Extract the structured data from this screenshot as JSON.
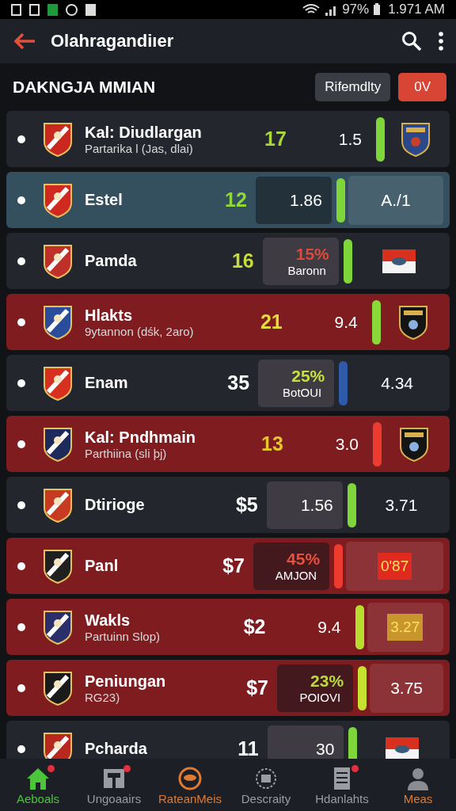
{
  "status_bar": {
    "battery": "97%",
    "time": "1.971 AM"
  },
  "app_bar": {
    "title": "Olahragandiıer"
  },
  "section": {
    "title": "DAKNGJA MMIAN",
    "buttons": [
      {
        "label": "Rifemdlty",
        "kind": "neutral"
      },
      {
        "label": "0V",
        "kind": "accent"
      }
    ]
  },
  "rows": [
    {
      "kind": "dark",
      "name": "Kal: Diudlargan",
      "sub": "Partarika l (Jas, dlai)",
      "count": {
        "text": "17",
        "color": "#a8d63c"
      },
      "value": {
        "kind": "plain",
        "text": "1.5"
      },
      "bar": {
        "color": "#7ed63a"
      },
      "right": {
        "kind": "crest"
      }
    },
    {
      "kind": "blue",
      "name": "Estel",
      "count": {
        "text": "12",
        "color": "#8fd83a"
      },
      "value": {
        "kind": "box",
        "text": "1.86"
      },
      "bar": {
        "color": "#7ed63a"
      },
      "right": {
        "kind": "box",
        "text": "A./1"
      }
    },
    {
      "kind": "dark",
      "name": "Pamda",
      "count": {
        "text": "16",
        "color": "#c6dc3c"
      },
      "value": {
        "kind": "percent",
        "text": "15%",
        "label": "Baronn",
        "color": "#e0483a"
      },
      "bar": {
        "color": "#7ed63a"
      },
      "right": {
        "kind": "flag"
      }
    },
    {
      "kind": "red",
      "name": "Hlakts",
      "sub": "9ytannon (dśk, 2aro)",
      "count": {
        "text": "21",
        "color": "#e2dc3c"
      },
      "value": {
        "kind": "plain",
        "text": "9.4"
      },
      "bar": {
        "color": "#8ad83a"
      },
      "right": {
        "kind": "crest"
      }
    },
    {
      "kind": "dark",
      "name": "Enam",
      "count": {
        "text": "35",
        "color": "#ffffff"
      },
      "value": {
        "kind": "percent",
        "text": "25%",
        "label": "BotOUI",
        "color": "#c6e03c"
      },
      "bar": {
        "color": "#2f5aa8"
      },
      "right": {
        "kind": "plain",
        "text": "4.34"
      }
    },
    {
      "kind": "red",
      "name": "Kal: Pndhmain",
      "sub": "Parthiina (sli þj)",
      "count": {
        "text": "13",
        "color": "#e6c430"
      },
      "value": {
        "kind": "plain",
        "text": "3.0"
      },
      "bar": {
        "color": "#ee3b30"
      },
      "right": {
        "kind": "crest"
      }
    },
    {
      "kind": "dark",
      "name": "Dtiriоge",
      "count": {
        "text": "$5",
        "color": "#ffffff"
      },
      "value": {
        "kind": "box",
        "text": "1.56"
      },
      "bar": {
        "color": "#7ed63a"
      },
      "right": {
        "kind": "plain",
        "text": "3.71"
      }
    },
    {
      "kind": "red",
      "name": "Panl",
      "count": {
        "text": "$7",
        "color": "#ffffff"
      },
      "value": {
        "kind": "percent",
        "text": "45%",
        "label": "AMJON",
        "color": "#e8503c"
      },
      "bar": {
        "color": "#ee3b30"
      },
      "right": {
        "kind": "tag",
        "text": "0'87",
        "color": "#e02a20"
      }
    },
    {
      "kind": "red",
      "name": "Wakls",
      "sub": "Partuinn Slop)",
      "count": {
        "text": "$2",
        "color": "#ffffff"
      },
      "value": {
        "kind": "plain",
        "text": "9.4"
      },
      "bar": {
        "color": "#b8dc30"
      },
      "right": {
        "kind": "tag",
        "text": "3.27",
        "color": "#c8962c"
      }
    },
    {
      "kind": "red",
      "name": "Peniungan",
      "sub": "RG23)",
      "count": {
        "text": "$7",
        "color": "#ffffff"
      },
      "value": {
        "kind": "percent",
        "text": "23%",
        "label": "POIOVI",
        "color": "#b8dc3c"
      },
      "bar": {
        "color": "#c8e030"
      },
      "right": {
        "kind": "box",
        "text": "3.75"
      }
    },
    {
      "kind": "dark",
      "name": "Pcharda",
      "count": {
        "text": "11",
        "color": "#ffffff"
      },
      "value": {
        "kind": "box",
        "text": "30"
      },
      "bar": {
        "color": "#7ed63a"
      },
      "right": {
        "kind": "flag"
      }
    }
  ],
  "nav": [
    {
      "label": "Aeboals",
      "color": "#4cc43c",
      "badge": true
    },
    {
      "label": "Ungoaairs",
      "color": "#9a9ca2",
      "badge": true
    },
    {
      "label": "RateanMeis",
      "color": "#e07a30",
      "badge": false
    },
    {
      "label": "Descraity",
      "color": "#9a9ca2",
      "badge": false
    },
    {
      "label": "Hdanlahts",
      "color": "#9a9ca2",
      "badge": true
    },
    {
      "label": "Meas",
      "color": "#e07a30",
      "badge": false
    }
  ]
}
